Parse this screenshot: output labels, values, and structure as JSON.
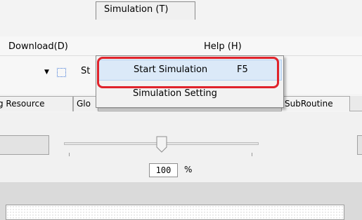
{
  "menubar": {
    "download": "Download(D)",
    "simulation": "Simulation (T)",
    "help": "Help (H)"
  },
  "toolbar": {
    "text": "St"
  },
  "tabs": [
    "g Resource",
    "Glo",
    "SubRoutine"
  ],
  "dropdown": {
    "items": [
      {
        "label": "Start Simulation",
        "shortcut": "F5",
        "highlighted": true
      },
      {
        "label": "Simulation Setting",
        "shortcut": ""
      }
    ]
  },
  "zoom": {
    "value": "100",
    "unit": "%",
    "slider_level": 0.5
  },
  "colors": {
    "highlight_border": "#e0232b",
    "hover_fill": "#dbe9f8"
  },
  "icons": [
    "dropdown-arrow-icon",
    "select-box-icon",
    "slider-thumb-icon"
  ]
}
